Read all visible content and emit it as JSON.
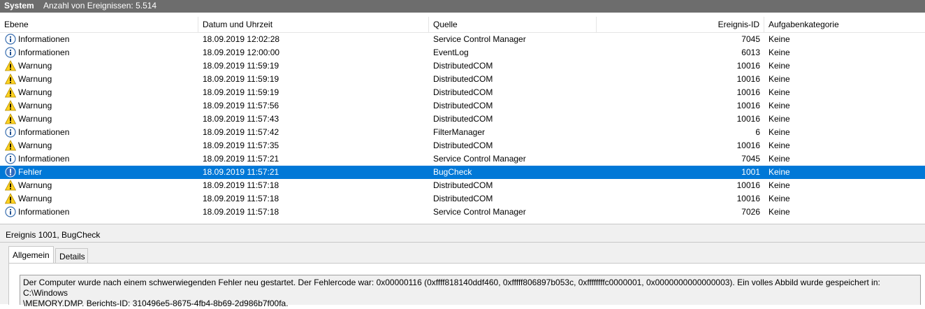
{
  "window": {
    "title": "System",
    "event_count_label": "Anzahl von Ereignissen: 5.514"
  },
  "columns": {
    "level": "Ebene",
    "date": "Datum und Uhrzeit",
    "source": "Quelle",
    "id": "Ereignis-ID",
    "task": "Aufgabenkategorie"
  },
  "events": [
    {
      "level": "Informationen",
      "icon": "info-icon",
      "date": "18.09.2019 12:02:28",
      "source": "Service Control Manager",
      "id": "7045",
      "task": "Keine",
      "selected": false
    },
    {
      "level": "Informationen",
      "icon": "info-icon",
      "date": "18.09.2019 12:00:00",
      "source": "EventLog",
      "id": "6013",
      "task": "Keine",
      "selected": false
    },
    {
      "level": "Warnung",
      "icon": "warning-icon",
      "date": "18.09.2019 11:59:19",
      "source": "DistributedCOM",
      "id": "10016",
      "task": "Keine",
      "selected": false
    },
    {
      "level": "Warnung",
      "icon": "warning-icon",
      "date": "18.09.2019 11:59:19",
      "source": "DistributedCOM",
      "id": "10016",
      "task": "Keine",
      "selected": false
    },
    {
      "level": "Warnung",
      "icon": "warning-icon",
      "date": "18.09.2019 11:59:19",
      "source": "DistributedCOM",
      "id": "10016",
      "task": "Keine",
      "selected": false
    },
    {
      "level": "Warnung",
      "icon": "warning-icon",
      "date": "18.09.2019 11:57:56",
      "source": "DistributedCOM",
      "id": "10016",
      "task": "Keine",
      "selected": false
    },
    {
      "level": "Warnung",
      "icon": "warning-icon",
      "date": "18.09.2019 11:57:43",
      "source": "DistributedCOM",
      "id": "10016",
      "task": "Keine",
      "selected": false
    },
    {
      "level": "Informationen",
      "icon": "info-icon",
      "date": "18.09.2019 11:57:42",
      "source": "FilterManager",
      "id": "6",
      "task": "Keine",
      "selected": false
    },
    {
      "level": "Warnung",
      "icon": "warning-icon",
      "date": "18.09.2019 11:57:35",
      "source": "DistributedCOM",
      "id": "10016",
      "task": "Keine",
      "selected": false
    },
    {
      "level": "Informationen",
      "icon": "info-icon",
      "date": "18.09.2019 11:57:21",
      "source": "Service Control Manager",
      "id": "7045",
      "task": "Keine",
      "selected": false
    },
    {
      "level": "Fehler",
      "icon": "error-icon",
      "date": "18.09.2019 11:57:21",
      "source": "BugCheck",
      "id": "1001",
      "task": "Keine",
      "selected": true
    },
    {
      "level": "Warnung",
      "icon": "warning-icon",
      "date": "18.09.2019 11:57:18",
      "source": "DistributedCOM",
      "id": "10016",
      "task": "Keine",
      "selected": false
    },
    {
      "level": "Warnung",
      "icon": "warning-icon",
      "date": "18.09.2019 11:57:18",
      "source": "DistributedCOM",
      "id": "10016",
      "task": "Keine",
      "selected": false
    },
    {
      "level": "Informationen",
      "icon": "info-icon",
      "date": "18.09.2019 11:57:18",
      "source": "Service Control Manager",
      "id": "7026",
      "task": "Keine",
      "selected": false
    }
  ],
  "detail": {
    "title": "Ereignis 1001, BugCheck",
    "tabs": [
      "Allgemein",
      "Details"
    ],
    "active_tab": "Allgemein",
    "message_line1": "Der Computer wurde nach einem schwerwiegenden Fehler neu gestartet. Der Fehlercode war: 0x00000116 (0xffff818140ddf460, 0xfffff806897b053c, 0xffffffffc0000001, 0x0000000000000003). Ein volles Abbild wurde gespeichert in: C:\\Windows",
    "message_line2": "\\MEMORY.DMP. Berichts-ID: 310496e5-8675-4fb4-8b69-2d986b7f00fa."
  },
  "colors": {
    "selection": "#0078d7",
    "titlebar": "#6d6d6d"
  }
}
